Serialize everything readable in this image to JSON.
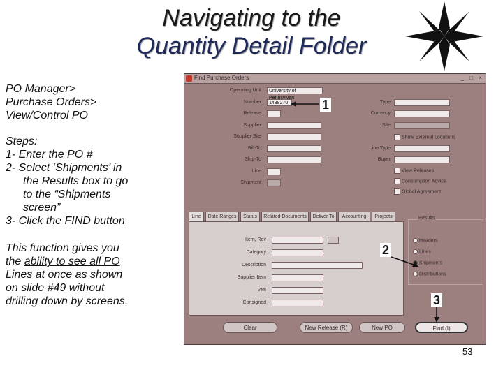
{
  "slide": {
    "title_line1": "Navigating to the",
    "title_line2": "Quantity Detail Folder",
    "page_number": "53"
  },
  "left_text": {
    "nav_path": [
      "PO Manager>",
      "Purchase Orders>",
      "View/Control PO"
    ],
    "steps_heading": "Steps:",
    "step1": "1- Enter the PO #",
    "step2_line1": "2- Select ‘Shipments’ in",
    "step2_line2": "the Results box to go",
    "step2_line3": "to the “Shipments",
    "step2_line4": "screen”",
    "step3": "3- Click the FIND button",
    "note_line1": "This function gives you",
    "note_line2_pre": "the ",
    "note_line2_u": "ability to see all PO",
    "note_line3_u": "Lines at once",
    "note_line3_post": " as shown",
    "note_line4": "on slide #49 without",
    "note_line5": "drilling down by screens."
  },
  "window": {
    "title": "Find Purchase Orders",
    "controls": "_ □ ×",
    "fields_left": [
      {
        "label": "Operating Unit",
        "value": "University of Pennsylvan"
      },
      {
        "label": "Number",
        "value": "1438270"
      },
      {
        "label": "Release",
        "value": ""
      },
      {
        "label": "Supplier",
        "value": ""
      },
      {
        "label": "Supplier Site",
        "value": ""
      },
      {
        "label": "Bill-To",
        "value": ""
      },
      {
        "label": "Ship-To",
        "value": ""
      },
      {
        "label": "Line",
        "value": ""
      },
      {
        "label": "Shipment",
        "value": ""
      }
    ],
    "fields_right": [
      {
        "label": "Type",
        "value": ""
      },
      {
        "label": "Currency",
        "value": ""
      },
      {
        "label": "Site",
        "value": ""
      },
      {
        "label": "Line Type",
        "value": ""
      },
      {
        "label": "Buyer",
        "value": ""
      }
    ],
    "checkboxes": [
      "Show External Locations",
      "View Releases",
      "Consumption Advice",
      "Global Agreement"
    ],
    "tabs": [
      "Line",
      "Date Ranges",
      "Status",
      "Related Documents",
      "Deliver To",
      "Accounting",
      "Projects"
    ],
    "line_fields": [
      "Item, Rev",
      "Category",
      "Description",
      "Supplier Item",
      "VMI",
      "Consigned"
    ],
    "results_label": "Results",
    "results": [
      "Headers",
      "Lines",
      "Shipments",
      "Distributions"
    ],
    "selected_result": "Shipments",
    "buttons": {
      "clear": "Clear",
      "new_release": "New Release (R)",
      "new_po": "New PO",
      "find": "Find (I)"
    }
  },
  "callouts": [
    "1",
    "2",
    "3"
  ],
  "icons": {
    "compass": "compass-star-icon",
    "app": "oracle-app-icon"
  }
}
